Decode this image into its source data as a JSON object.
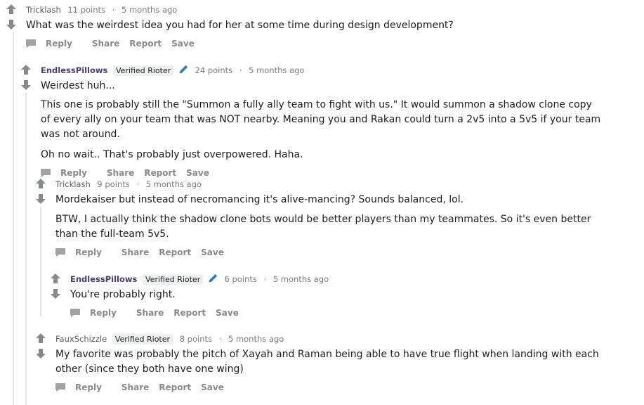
{
  "colors": {
    "arrow": "#878a8c",
    "pen": "#2f7fc1",
    "rioter": "#4a3a7a"
  },
  "comments": [
    {
      "author": "Tricklash",
      "points": "11 points",
      "time": "5 months ago",
      "paragraphs": [
        "What was the weirdest idea you had for her at some time during design development?"
      ],
      "actions": [
        "Reply",
        "Share",
        "Report",
        "Save"
      ]
    },
    {
      "author": "EndlessPillows",
      "flair": "Verified Rioter",
      "points": "24 points",
      "time": "5 months ago",
      "paragraphs": [
        "Weirdest huh...",
        "This one is probably still the \"Summon a fully ally team to fight with us.\" It would summon a shadow clone copy of every ally on your team that was NOT nearby. Meaning you and Rakan could turn a 2v5 into a 5v5 if your team was not around.",
        "Oh no wait.. That's probably just overpowered. Haha."
      ],
      "actions": [
        "Reply",
        "Share",
        "Report",
        "Save"
      ]
    },
    {
      "author": "Tricklash",
      "points": "9 points",
      "time": "5 months ago",
      "paragraphs": [
        "Mordekaiser but instead of necromancing it's alive-mancing? Sounds balanced, lol.",
        "BTW, I actually think the shadow clone bots would be better players than my teammates. So it's even better than the full-team 5v5."
      ],
      "actions": [
        "Reply",
        "Share",
        "Report",
        "Save"
      ]
    },
    {
      "author": "EndlessPillows",
      "flair": "Verified Rioter",
      "points": "6 points",
      "time": "5 months ago",
      "paragraphs": [
        "You're probably right."
      ],
      "actions": [
        "Reply",
        "Share",
        "Report",
        "Save"
      ]
    },
    {
      "author": "FauxSchizzle",
      "flair": "Verified Rioter",
      "points": "8 points",
      "time": "5 months ago",
      "paragraphs": [
        "My favorite was probably the pitch of Xayah and Raman being able to have true flight when landing with each other (since they both have one wing)"
      ],
      "actions": [
        "Reply",
        "Share",
        "Report",
        "Save"
      ]
    }
  ]
}
